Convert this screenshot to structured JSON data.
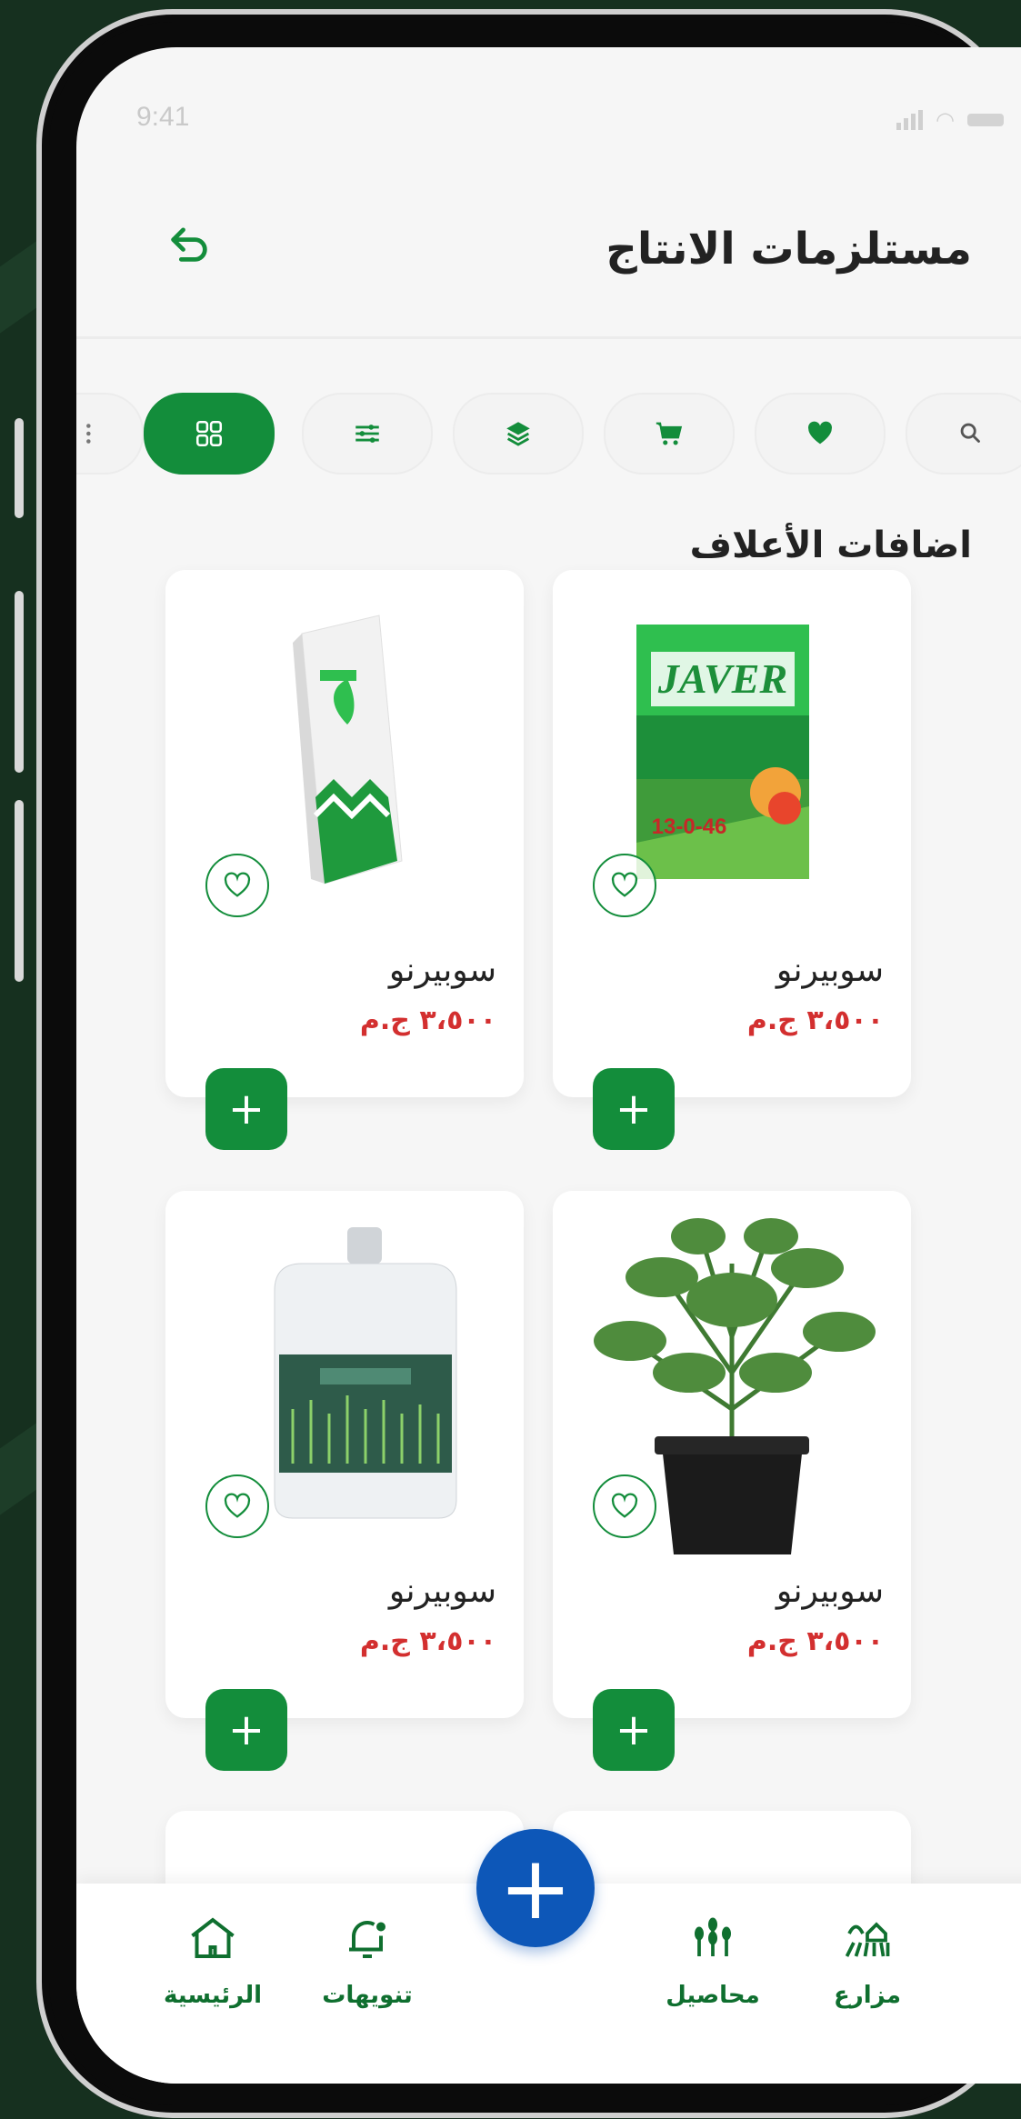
{
  "status_bar": {
    "time": "9:41"
  },
  "header": {
    "title": "مستلزمات الانتاج"
  },
  "toolbar": {
    "chips": [
      {
        "name": "more-chip",
        "icon": "more-vertical-icon"
      },
      {
        "name": "grid-view-chip",
        "icon": "grid-icon",
        "active": true
      },
      {
        "name": "filter-chip",
        "icon": "sliders-icon"
      },
      {
        "name": "layers-chip",
        "icon": "layers-icon"
      },
      {
        "name": "cart-chip",
        "icon": "cart-icon"
      },
      {
        "name": "favorites-chip",
        "icon": "heart-icon"
      },
      {
        "name": "search-chip",
        "icon": "search-icon"
      }
    ]
  },
  "section": {
    "title": "اضافات الأعلاف"
  },
  "products": [
    {
      "name": "سوبيرنو",
      "price": "٣،٥٠٠ ج.م",
      "image": "fertilizer-box"
    },
    {
      "name": "سوبيرنو",
      "price": "٣،٥٠٠ ج.م",
      "image": "fertilizer-bag"
    },
    {
      "name": "سوبيرنو",
      "price": "٣،٥٠٠ ج.م",
      "image": "potted-plant"
    },
    {
      "name": "سوبيرنو",
      "price": "٣،٥٠٠ ج.م",
      "image": "liquid-jerrycan"
    }
  ],
  "bottom_nav": {
    "items": [
      {
        "label": "مزارع",
        "icon": "farm-icon"
      },
      {
        "label": "محاصيل",
        "icon": "crops-icon"
      },
      {
        "label": "تنويهات",
        "icon": "bell-icon"
      },
      {
        "label": "الرئيسية",
        "icon": "home-icon"
      }
    ],
    "fab_label": "+"
  },
  "colors": {
    "primary": "#138d3b",
    "accent": "#0d57b8",
    "price": "#d32f2f"
  }
}
